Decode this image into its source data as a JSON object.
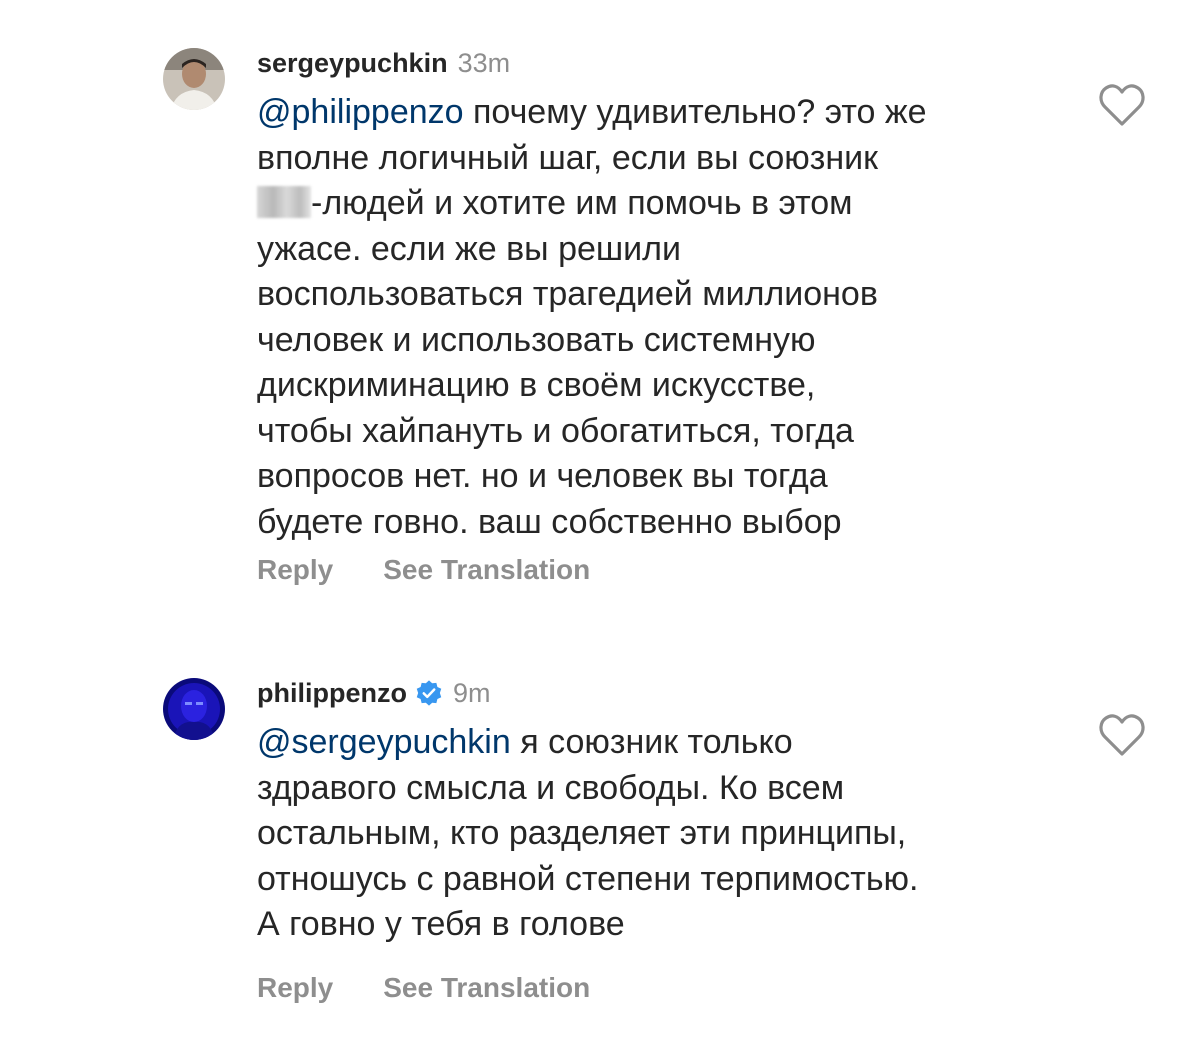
{
  "comments": [
    {
      "username": "sergeypuchkin",
      "time": "33m",
      "verified": false,
      "avatar_icon": "user-photo-avatar",
      "mention": "@philippenzo",
      "lines": [
        " почему удивительно? это же",
        "вполне логичный шаг, если вы союзник",
        "-людей и хотите им помочь в этом",
        "ужасе. если же вы решили",
        "воспользоваться трагедией миллионов",
        "человек и использовать системную",
        "дискриминацию в своём искусстве,",
        "чтобы хайпануть и обогатиться, тогда",
        "вопросов нет. но и человек вы тогда",
        "будете говно. ваш собственно выбор"
      ],
      "reply_label": "Reply",
      "translate_label": "See Translation"
    },
    {
      "username": "philippenzo",
      "time": "9m",
      "verified": true,
      "avatar_icon": "user-photo-avatar",
      "mention": "@sergeypuchkin",
      "lines": [
        " я союзник только",
        "здравого смысла и свободы. Ко всем",
        "остальным, кто разделяет эти принципы,",
        "отношусь с равной степени терпимостью.",
        "А говно у тебя в голове"
      ],
      "reply_label": "Reply",
      "translate_label": "See Translation"
    }
  ],
  "colors": {
    "text": "#262626",
    "secondary": "#8e8e8e",
    "mention": "#00376b",
    "verified": "#3897f0"
  }
}
